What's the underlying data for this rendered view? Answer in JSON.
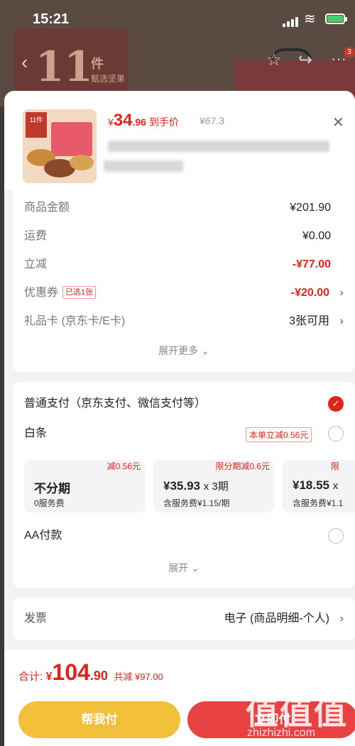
{
  "status_bar": {
    "time": "15:21"
  },
  "background_page": {
    "poster_number": "11",
    "poster_unit": "件",
    "poster_sub": "甄选坚果",
    "cart_badge": "3"
  },
  "product": {
    "price_symbol": "¥",
    "price_int": "34",
    "price_dec": ".96",
    "price_label": "到手价",
    "original_price": "¥67.3",
    "thumb_tag": "11件"
  },
  "summary": {
    "rows": [
      {
        "label": "商品金额",
        "value": "¥201.90"
      },
      {
        "label": "运费",
        "value": "¥0.00"
      },
      {
        "label": "立减",
        "value": "-¥77.00"
      },
      {
        "label": "优惠券",
        "tag": "已选1张",
        "value": "-¥20.00"
      },
      {
        "label": "礼品卡 (京东卡/E卡)",
        "value": "3张可用"
      }
    ],
    "expand_label": "展开更多 ⌄"
  },
  "payment": {
    "normal_label": "普通支付（京东支付、微信支付等）",
    "baitiao_label": "白条",
    "baitiao_promo": "本单立减0.56元",
    "installments": [
      {
        "discount": "减0.56元",
        "main": "不分期",
        "times": "",
        "fee": "0服务费"
      },
      {
        "discount": "限分期减0.6元",
        "main": "¥35.93",
        "times": "x 3期",
        "fee": "含服务费¥1.15/期"
      },
      {
        "discount": "限",
        "main": "¥18.55",
        "times": "x",
        "fee": "含服务费¥1.1"
      }
    ],
    "aa_label": "AA付款",
    "expand_label": "展开 ⌄"
  },
  "invoice": {
    "label": "发票",
    "value": "电子 (商品明细-个人)"
  },
  "footer": {
    "total_label": "合计:",
    "total_symbol": "¥",
    "total_int": "104",
    "total_dec": ".90",
    "total_saving": "共减 ¥97.00",
    "help_pay_label": "帮我付",
    "pay_label": "立即付"
  },
  "watermark": {
    "big": "值值值",
    "small": "zhizhizhi.com"
  },
  "colors": {
    "accent_red": "#e2231a",
    "help_yellow": "#f3c03c",
    "pay_red": "#e84141"
  }
}
